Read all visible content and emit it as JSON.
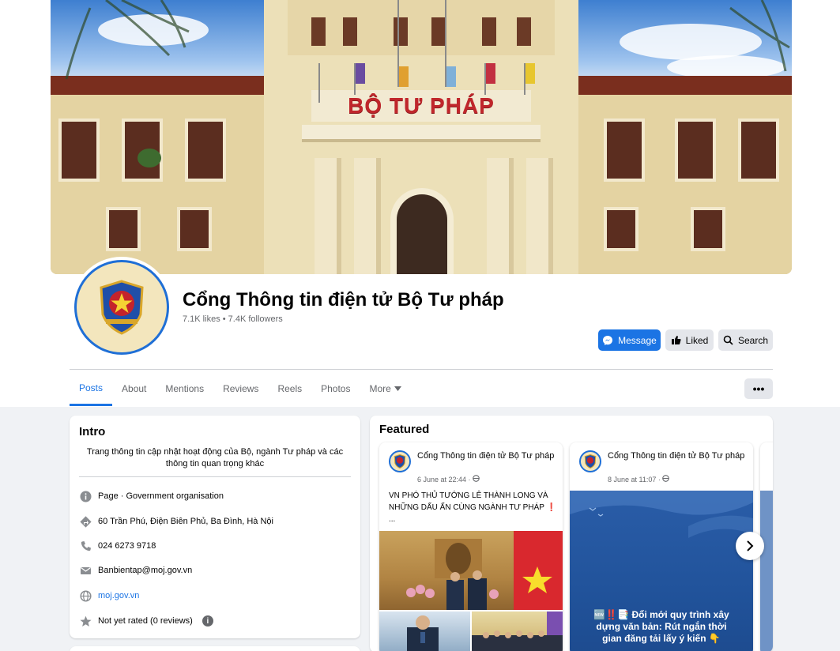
{
  "page": {
    "name": "Cổng Thông tin điện tử Bộ Tư pháp",
    "stats": "7.1K likes • 7.4K followers",
    "cover_sign": "BỘ TƯ PHÁP"
  },
  "actions": {
    "message": "Message",
    "liked": "Liked",
    "search": "Search"
  },
  "tabs": [
    {
      "label": "Posts",
      "active": true
    },
    {
      "label": "About"
    },
    {
      "label": "Mentions"
    },
    {
      "label": "Reviews"
    },
    {
      "label": "Reels"
    },
    {
      "label": "Photos"
    },
    {
      "label": "More"
    }
  ],
  "more_options": "•••",
  "intro": {
    "title": "Intro",
    "bio": "Trang thông tin cập nhật hoạt động của Bộ, ngành Tư pháp và các thông tin quan trọng khác",
    "category": "Page · Government organisation",
    "address": "60 Trần Phú, Điện Biên Phủ, Ba Đình, Hà Nội",
    "phone": "024 6273 9718",
    "email": "Banbientap@moj.gov.vn",
    "website": "moj.gov.vn",
    "rating": "Not yet rated (0 reviews)",
    "rating_info": "i"
  },
  "featured": {
    "title": "Featured",
    "posts": [
      {
        "author": "Cổng Thông tin điện tử Bộ Tư pháp",
        "time": "6 June at 22:44 · ",
        "text": "VN PHÓ THỦ TƯỚNG LÊ THÀNH LONG VÀ NHỮNG DẤU ẤN CÙNG NGÀNH TƯ PHÁP ❗ ..."
      },
      {
        "author": "Cổng Thông tin điện tử Bộ Tư pháp",
        "time": "8 June at 11:07 · ",
        "image_text": "🆕‼️📑 Đổi mới quy trình xây dựng văn bản: Rút ngắn thời gian đăng tải lấy ý kiến 👇"
      }
    ],
    "next_glyph": "›"
  },
  "colors": {
    "accent": "#1b74e4",
    "muted_text": "#65676b",
    "button_gray": "#e4e6eb",
    "page_bg": "#f0f2f5"
  },
  "icons": {
    "message": "messenger-icon",
    "liked": "thumbs-up-icon",
    "search": "search-icon",
    "more_tab": "caret-down-icon",
    "info": "info-icon",
    "address": "map-pin-icon",
    "phone": "phone-icon",
    "email": "mail-icon",
    "website": "globe-icon",
    "rating": "star-icon",
    "globe_small": "globe-icon",
    "next": "chevron-right-icon"
  }
}
